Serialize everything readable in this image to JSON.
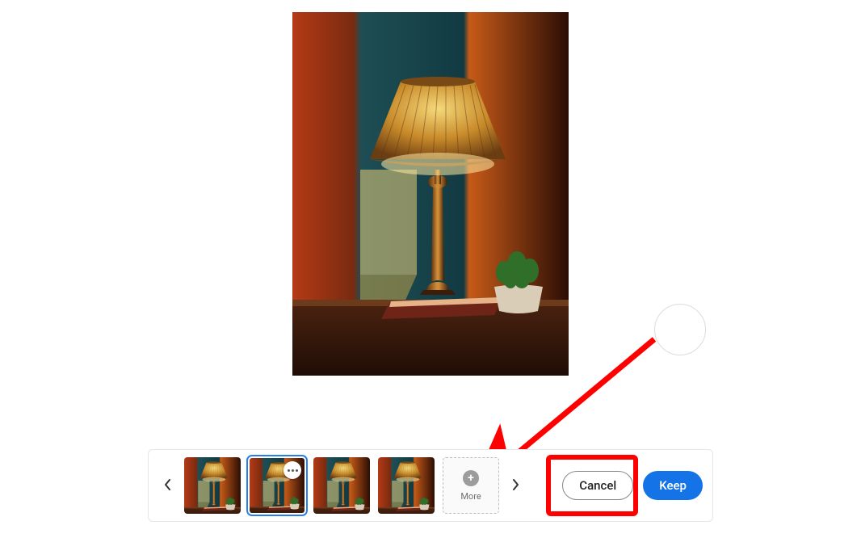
{
  "preview": {
    "alt": "Variation preview: table lamp with pleated shade on a wooden desk, teal wall, potted plant"
  },
  "variation_bar": {
    "prev_label": "Previous",
    "next_label": "Next",
    "thumbs": [
      {
        "alt": "Variation 1"
      },
      {
        "alt": "Variation 2 (selected)"
      },
      {
        "alt": "Variation 3"
      },
      {
        "alt": "Variation 4"
      }
    ],
    "selected_index": 1,
    "more_label": "More",
    "cancel_label": "Cancel",
    "keep_label": "Keep"
  },
  "annotations": {
    "highlight_target": "cancel-button"
  }
}
